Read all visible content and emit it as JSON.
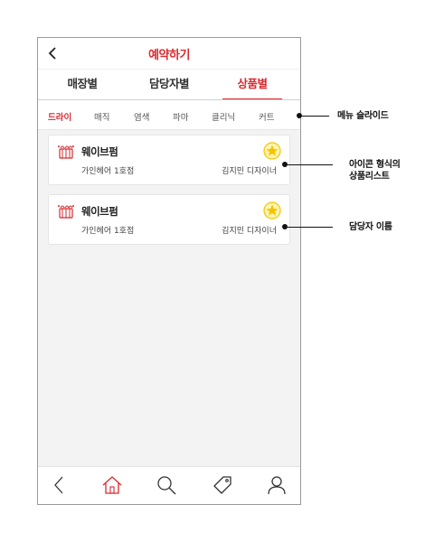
{
  "header": {
    "title": "예약하기"
  },
  "tabs": [
    {
      "label": "매장별",
      "active": false
    },
    {
      "label": "담당자별",
      "active": false
    },
    {
      "label": "상품별",
      "active": true
    }
  ],
  "submenu": [
    {
      "label": "드라이",
      "active": true
    },
    {
      "label": "매직",
      "active": false
    },
    {
      "label": "염색",
      "active": false
    },
    {
      "label": "파마",
      "active": false
    },
    {
      "label": "클리닉",
      "active": false
    },
    {
      "label": "커트",
      "active": false
    }
  ],
  "products": [
    {
      "name": "웨이브펌",
      "store": "가인헤어 1호점",
      "designer": "김지민 디자이너",
      "favorite": true
    },
    {
      "name": "웨이브펌",
      "store": "가인헤어 1호점",
      "designer": "김지민 디자이너",
      "favorite": true
    }
  ],
  "annotations": {
    "menu_slide": "메뉴 슬라이드",
    "icon_list_line1": "아이콘 형식의",
    "icon_list_line2": "상품리스트",
    "designer_name": "담당자 이름"
  },
  "tabbar": [
    "back-icon",
    "home-icon",
    "search-icon",
    "tag-icon",
    "user-icon"
  ],
  "colors": {
    "accent": "#d9292f",
    "star": "#f5c400"
  }
}
